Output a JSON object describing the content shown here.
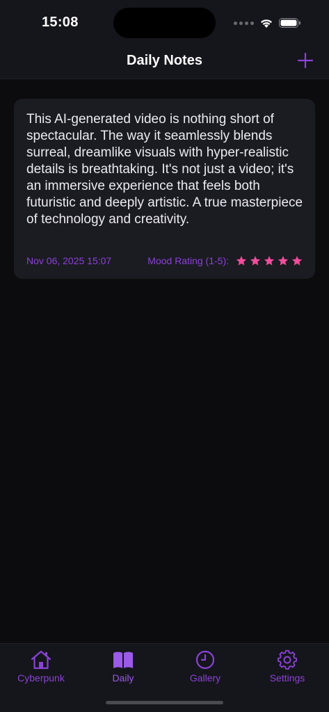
{
  "status_bar": {
    "time": "15:08"
  },
  "nav": {
    "title": "Daily Notes",
    "add_icon": "plus-icon"
  },
  "notes": [
    {
      "text": "This AI-generated video is nothing short of spectacular. The way it seamlessly blends surreal, dreamlike visuals with hyper-realistic details is breathtaking. It's not just a video; it's an immersive experience that feels both futuristic and deeply artistic. A true masterpiece of technology and creativity.",
      "date": "Nov 06, 2025 15:07",
      "mood_label": "Mood Rating (1-5):",
      "mood_rating": 5
    }
  ],
  "tabs": [
    {
      "label": "Cyberpunk",
      "icon": "house-icon",
      "active": false
    },
    {
      "label": "Daily",
      "icon": "book-icon",
      "active": true
    },
    {
      "label": "Gallery",
      "icon": "clock-icon",
      "active": false
    },
    {
      "label": "Settings",
      "icon": "gear-icon",
      "active": false
    }
  ],
  "colors": {
    "background": "#0c0c0e",
    "bar_background": "#15151c",
    "card_background": "#1b1b22",
    "accent_purple": "#8a43d6",
    "star_pink": "#f04d9b",
    "text_primary": "#ecebf2"
  }
}
